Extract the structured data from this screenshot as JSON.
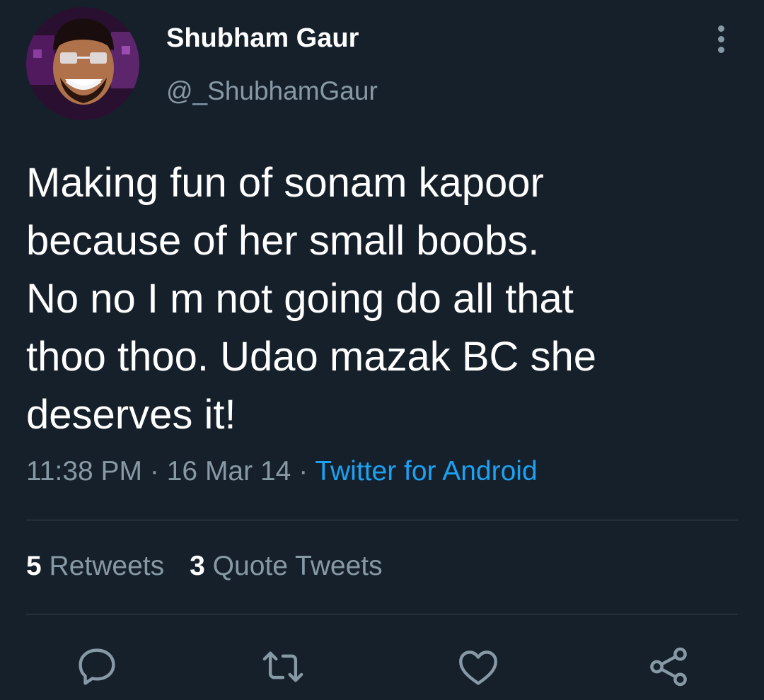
{
  "tweet": {
    "author": {
      "display_name": "Shubham Gaur",
      "handle": "@_ShubhamGaur"
    },
    "text": "Making fun of sonam kapoor\nbecause of her small boobs.\nNo no I m not going do all that\nthoo thoo. Udao mazak BC she\ndeserves it!",
    "time": "11:38 PM",
    "date": "16 Mar 14",
    "separator": "·",
    "source": "Twitter for Android",
    "stats": {
      "retweets_count": "5",
      "retweets_label": "Retweets",
      "quote_tweets_count": "3",
      "quote_tweets_label": "Quote Tweets"
    }
  },
  "actions": {
    "icons": [
      "reply-icon",
      "retweet-icon",
      "like-icon",
      "share-icon"
    ]
  },
  "colors": {
    "background": "#15202b",
    "secondary_text": "#8899a6",
    "link": "#1da1f2",
    "divider": "#38444d"
  }
}
